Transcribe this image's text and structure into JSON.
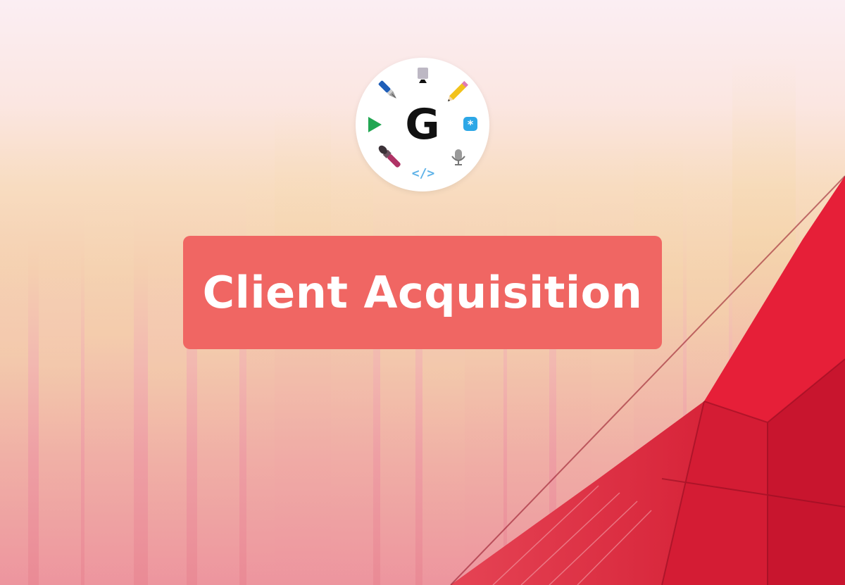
{
  "banner": {
    "title": "Client Acquisition"
  },
  "logo": {
    "letter": "G",
    "icons": [
      "monitor-icon",
      "pencil-icon",
      "asterisk-badge-icon",
      "microphone-icon",
      "code-icon",
      "paintbrush-icon",
      "play-icon",
      "fountain-pen-icon"
    ]
  },
  "colors": {
    "banner": "#f06663",
    "banner_text": "#ffffff",
    "logo_background": "#ffffff",
    "logo_letter": "#111111",
    "building_glass": "#e8233a"
  }
}
